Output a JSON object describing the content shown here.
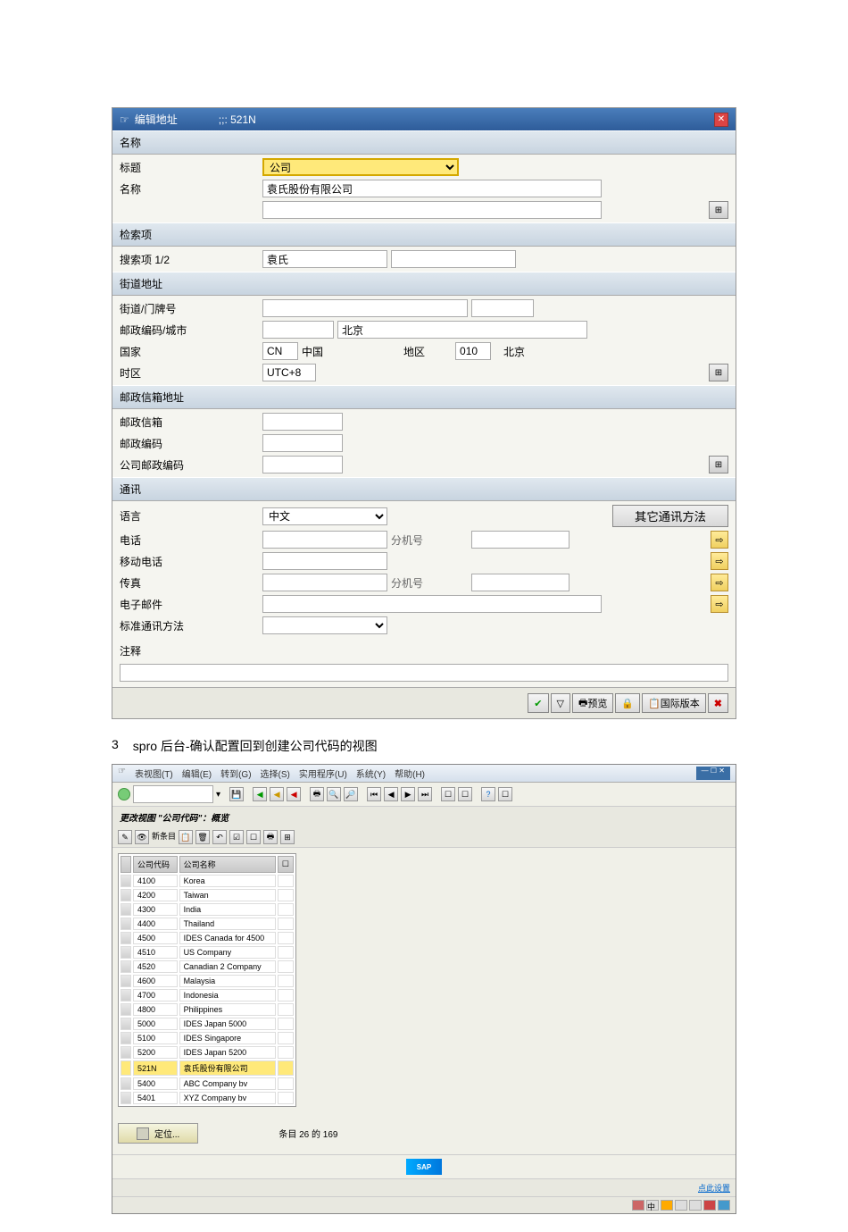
{
  "dialog": {
    "title": "编辑地址",
    "code": ";;: 521N",
    "sections": {
      "name": {
        "header": "名称",
        "title_label": "标题",
        "title_value": "公司",
        "name_label": "名称",
        "name_value": "袁氏股份有限公司"
      },
      "search": {
        "header": "检索项",
        "label": "搜索项 1/2",
        "value1": "袁氏",
        "value2": ""
      },
      "street": {
        "header": "街道地址",
        "street_label": "街道/门牌号",
        "street_value": "",
        "house_value": "",
        "postal_label": "邮政编码/城市",
        "postal_value": "",
        "city_value": "北京",
        "country_label": "国家",
        "country_code": "CN",
        "country_name": "中国",
        "region_label": "地区",
        "region_code": "010",
        "region_name": "北京",
        "timezone_label": "时区",
        "timezone_value": "UTC+8"
      },
      "pobox": {
        "header": "邮政信箱地址",
        "pobox_label": "邮政信箱",
        "pobox_value": "",
        "postal_label": "邮政编码",
        "postal_value": "",
        "company_postal_label": "公司邮政编码",
        "company_postal_value": ""
      },
      "comm": {
        "header": "通讯",
        "lang_label": "语言",
        "lang_value": "中文",
        "other_btn": "其它通讯方法",
        "phone_label": "电话",
        "phone_value": "",
        "ext_label": "分机号",
        "ext_value": "",
        "mobile_label": "移动电话",
        "mobile_value": "",
        "fax_label": "传真",
        "fax_value": "",
        "fax_ext_label": "分机号",
        "fax_ext_value": "",
        "email_label": "电子邮件",
        "email_value": "",
        "std_label": "标准通讯方法",
        "std_value": ""
      }
    },
    "comment_label": "注释",
    "comment_value": "",
    "actions": {
      "preview": "预览",
      "intl": "国际版本"
    }
  },
  "caption": {
    "num": "3",
    "text": "spro 后台-确认配置回到创建公司代码的视图"
  },
  "sap": {
    "menus": [
      "表视图(T)",
      "编辑(E)",
      "转到(G)",
      "选择(S)",
      "实用程序(U)",
      "系统(Y)",
      "帮助(H)"
    ],
    "view_title": "更改视图 \"公司代码\"：概览",
    "table": {
      "col1": "公司代码",
      "col2": "公司名称",
      "rows": [
        {
          "code": "4100",
          "name": "Korea"
        },
        {
          "code": "4200",
          "name": "Taiwan"
        },
        {
          "code": "4300",
          "name": "India"
        },
        {
          "code": "4400",
          "name": "Thailand"
        },
        {
          "code": "4500",
          "name": "IDES Canada for 4500"
        },
        {
          "code": "4510",
          "name": "US Company"
        },
        {
          "code": "4520",
          "name": "Canadian 2 Company"
        },
        {
          "code": "4600",
          "name": "Malaysia"
        },
        {
          "code": "4700",
          "name": "Indonesia"
        },
        {
          "code": "4800",
          "name": "Philippines"
        },
        {
          "code": "5000",
          "name": "IDES Japan 5000"
        },
        {
          "code": "5100",
          "name": "IDES Singapore"
        },
        {
          "code": "5200",
          "name": "IDES Japan 5200"
        },
        {
          "code": "521N",
          "name": "袁氏股份有限公司",
          "sel": true
        },
        {
          "code": "5400",
          "name": "ABC Company bv"
        },
        {
          "code": "5401",
          "name": "XYZ Company bv"
        }
      ]
    },
    "position_btn": "定位...",
    "entries": "条目 26 的 169",
    "status_link": "点此设置"
  }
}
